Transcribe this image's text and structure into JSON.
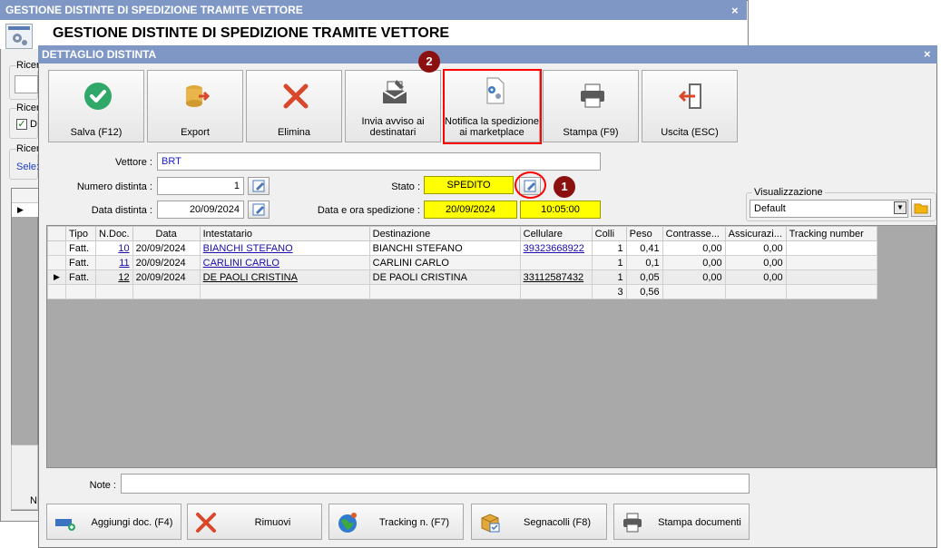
{
  "back_window": {
    "title": "GESTIONE DISTINTE DI SPEDIZIONE TRAMITE VETTORE",
    "heading": "GESTIONE DISTINTE DI SPEDIZIONE TRAMITE VETTORE",
    "close": "×",
    "group1_label": "Ricer",
    "group2_label": "Ricer",
    "group2_check": "D",
    "group3_label": "Ricer",
    "group3_value": "Sele:",
    "bottom_label": "N"
  },
  "window": {
    "title": "DETTAGLIO DISTINTA",
    "close": "×"
  },
  "toolbar": {
    "buttons": [
      {
        "label": "Salva (F12)",
        "icon": "check-icon"
      },
      {
        "label": "Export",
        "icon": "export-icon"
      },
      {
        "label": "Elimina",
        "icon": "delete-icon"
      },
      {
        "label": "Invia avviso ai destinatari",
        "icon": "mail-icon"
      },
      {
        "label": "Notifica la spedizione ai marketplace",
        "icon": "notify-gear-icon"
      },
      {
        "label": "Stampa (F9)",
        "icon": "printer-icon"
      },
      {
        "label": "Uscita (ESC)",
        "icon": "exit-icon"
      }
    ]
  },
  "markers": {
    "one": "1",
    "two": "2"
  },
  "form": {
    "vettore_label": "Vettore :",
    "vettore_value": "BRT",
    "numero_label": "Numero distinta :",
    "numero_value": "1",
    "data_label": "Data distinta :",
    "data_value": "20/09/2024",
    "stato_label": "Stato :",
    "stato_value": "SPEDITO",
    "spedizione_label": "Data e ora spedizione :",
    "spedizione_date": "20/09/2024",
    "spedizione_time": "10:05:00"
  },
  "visualizzazione": {
    "label": "Visualizzazione",
    "selected": "Default"
  },
  "grid": {
    "columns": [
      "Tipo",
      "N.Doc.",
      "Data",
      "Intestatario",
      "Destinazione",
      "Cellulare",
      "Colli",
      "Peso",
      "Contrasse...",
      "Assicurazi...",
      "Tracking number"
    ],
    "rows": [
      {
        "tipo": "Fatt.",
        "ndoc": "10",
        "data": "20/09/2024",
        "intestatario": "BIANCHI STEFANO",
        "destinazione": "BIANCHI STEFANO",
        "cellulare": "39323668922",
        "colli": "1",
        "peso": "0,41",
        "contrassegno": "0,00",
        "assicurazione": "0,00",
        "tracking": ""
      },
      {
        "tipo": "Fatt.",
        "ndoc": "11",
        "data": "20/09/2024",
        "intestatario": "CARLINI CARLO",
        "destinazione": "CARLINI CARLO",
        "cellulare": "",
        "colli": "1",
        "peso": "0,1",
        "contrassegno": "0,00",
        "assicurazione": "0,00",
        "tracking": ""
      },
      {
        "tipo": "Fatt.",
        "ndoc": "12",
        "data": "20/09/2024",
        "intestatario": "DE PAOLI CRISTINA",
        "destinazione": "DE PAOLI CRISTINA",
        "cellulare": "33112587432",
        "colli": "1",
        "peso": "0,05",
        "contrassegno": "0,00",
        "assicurazione": "0,00",
        "tracking": ""
      }
    ],
    "totals": {
      "colli": "3",
      "peso": "0,56"
    },
    "selected_marker": "▶"
  },
  "note": {
    "label": "Note :",
    "value": ""
  },
  "bottom_buttons": [
    {
      "label": "Aggiungi doc. (F4)",
      "icon": "add-doc-icon"
    },
    {
      "label": "Rimuovi",
      "icon": "remove-icon"
    },
    {
      "label": "Tracking n. (F7)",
      "icon": "globe-icon"
    },
    {
      "label": "Segnacolli (F8)",
      "icon": "package-icon"
    },
    {
      "label": "Stampa documenti",
      "icon": "printer-icon"
    }
  ],
  "colors": {
    "titlebar": "#7f97c4",
    "highlight": "#ff0000",
    "marker": "#8b1111",
    "yellow": "#ffff00"
  }
}
